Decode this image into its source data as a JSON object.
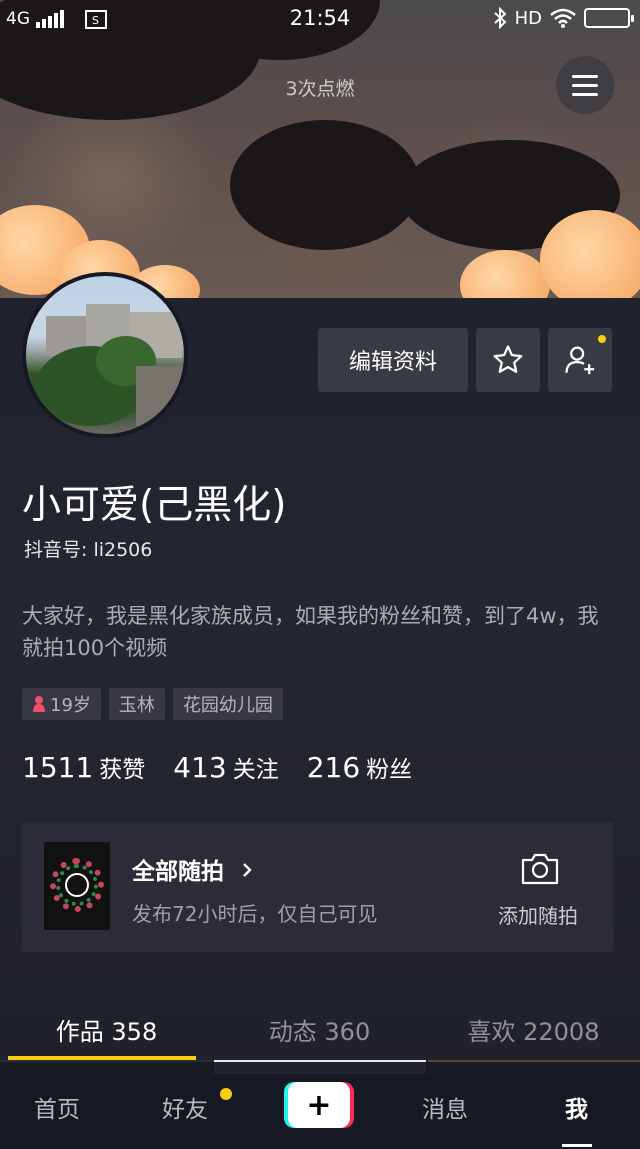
{
  "status_bar": {
    "network": "4G",
    "time": "21:54",
    "right": "HD"
  },
  "header": {
    "burn_text": "3次点燃"
  },
  "profile": {
    "edit_label": "编辑资料",
    "name": "小可爱(己黑化)",
    "douyin_id": "抖音号: li2506",
    "bio": "大家好，我是黑化家族成员，如果我的粉丝和赞，到了4w，我就拍100个视频",
    "tags": [
      "19岁",
      "玉林",
      "花园幼儿园"
    ],
    "stats": {
      "likes_num": "1511",
      "likes_label": "获赞",
      "following_num": "413",
      "following_label": "关注",
      "fans_num": "216",
      "fans_label": "粉丝"
    }
  },
  "moments_card": {
    "title": "全部随拍",
    "subtitle": "发布72小时后，仅自己可见",
    "add_label": "添加随拍"
  },
  "tabs": [
    {
      "label": "作品 358"
    },
    {
      "label": "动态 360"
    },
    {
      "label": "喜欢 22008"
    }
  ],
  "bottom_nav": {
    "home": "首页",
    "friends": "好友",
    "plus": "+",
    "messages": "消息",
    "me": "我"
  },
  "colors": {
    "accent_yellow": "#face15",
    "background": "#161823",
    "tiktok_cyan": "#25f4ee",
    "tiktok_red": "#fe2c55"
  }
}
